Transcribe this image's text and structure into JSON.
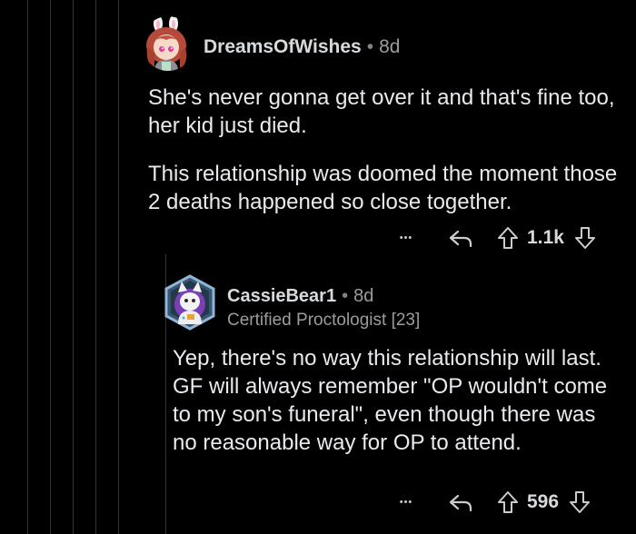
{
  "comments": [
    {
      "author": "DreamsOfWishes",
      "separator": "•",
      "age": "8d",
      "paragraphs": [
        "She's never gonna get over it and that's fine too, her kid just died.",
        "This relationship was doomed the moment those 2 deaths happened so close together."
      ],
      "more_label": "•••",
      "score": "1.1k",
      "icons": {
        "more": "more-icon",
        "reply": "reply-icon",
        "upvote": "upvote-icon",
        "downvote": "downvote-icon"
      }
    },
    {
      "author": "CassieBear1",
      "separator": "•",
      "age": "8d",
      "flair": "Certified Proctologist [23]",
      "paragraphs": [
        "Yep, there's no way this relationship will last. GF will always remember \"OP wouldn't come to my son's funeral\", even though there was no reasonable way for OP to attend."
      ],
      "more_label": "•••",
      "score": "596",
      "icons": {
        "more": "more-icon",
        "reply": "reply-icon",
        "upvote": "upvote-icon",
        "downvote": "downvote-icon"
      }
    }
  ],
  "colors": {
    "background": "#000000",
    "thread_line": "#343536",
    "text": "#e8eaed",
    "meta": "#9a9da0"
  }
}
